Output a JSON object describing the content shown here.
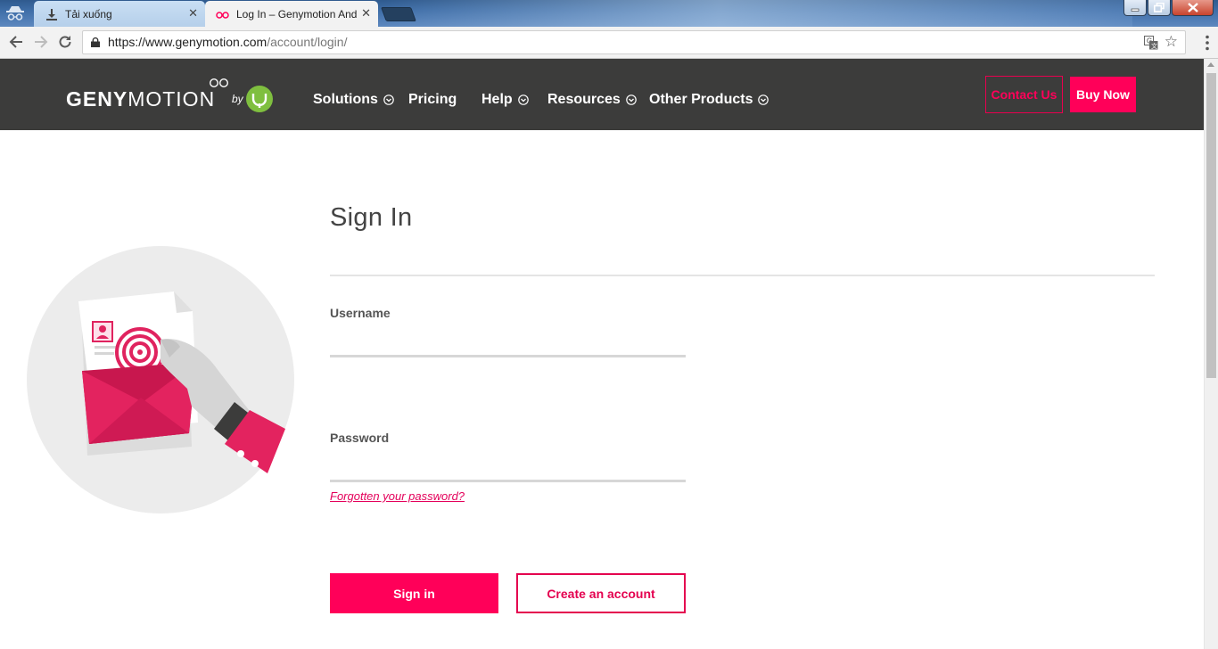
{
  "browser": {
    "tabs": [
      {
        "label": "Tải xuống",
        "icon": "download-icon"
      },
      {
        "label": "Log In – Genymotion And",
        "icon": "genymotion-favicon-icon"
      }
    ],
    "url_host": "https://www.genymotion.com",
    "url_path": "/account/login/"
  },
  "header": {
    "logo_text_bold": "GENY",
    "logo_text_light": "MOTION",
    "logo_by": "by",
    "nav": [
      {
        "label": "Solutions",
        "has_dropdown": true
      },
      {
        "label": "Pricing",
        "has_dropdown": false
      },
      {
        "label": "Help",
        "has_dropdown": true
      },
      {
        "label": "Resources",
        "has_dropdown": true
      },
      {
        "label": "Other Products",
        "has_dropdown": true
      }
    ],
    "contact_label": "Contact Us",
    "buy_label": "Buy Now"
  },
  "login": {
    "title": "Sign In",
    "username_label": "Username",
    "username_value": "",
    "password_label": "Password",
    "password_value": "",
    "forgot_label": "Forgotten your password?",
    "signin_label": "Sign in",
    "create_label": "Create an account"
  },
  "colors": {
    "brand_pink": "#ff0059",
    "header_bg": "#3c3c3b",
    "brand_green": "#7fbf3f"
  }
}
